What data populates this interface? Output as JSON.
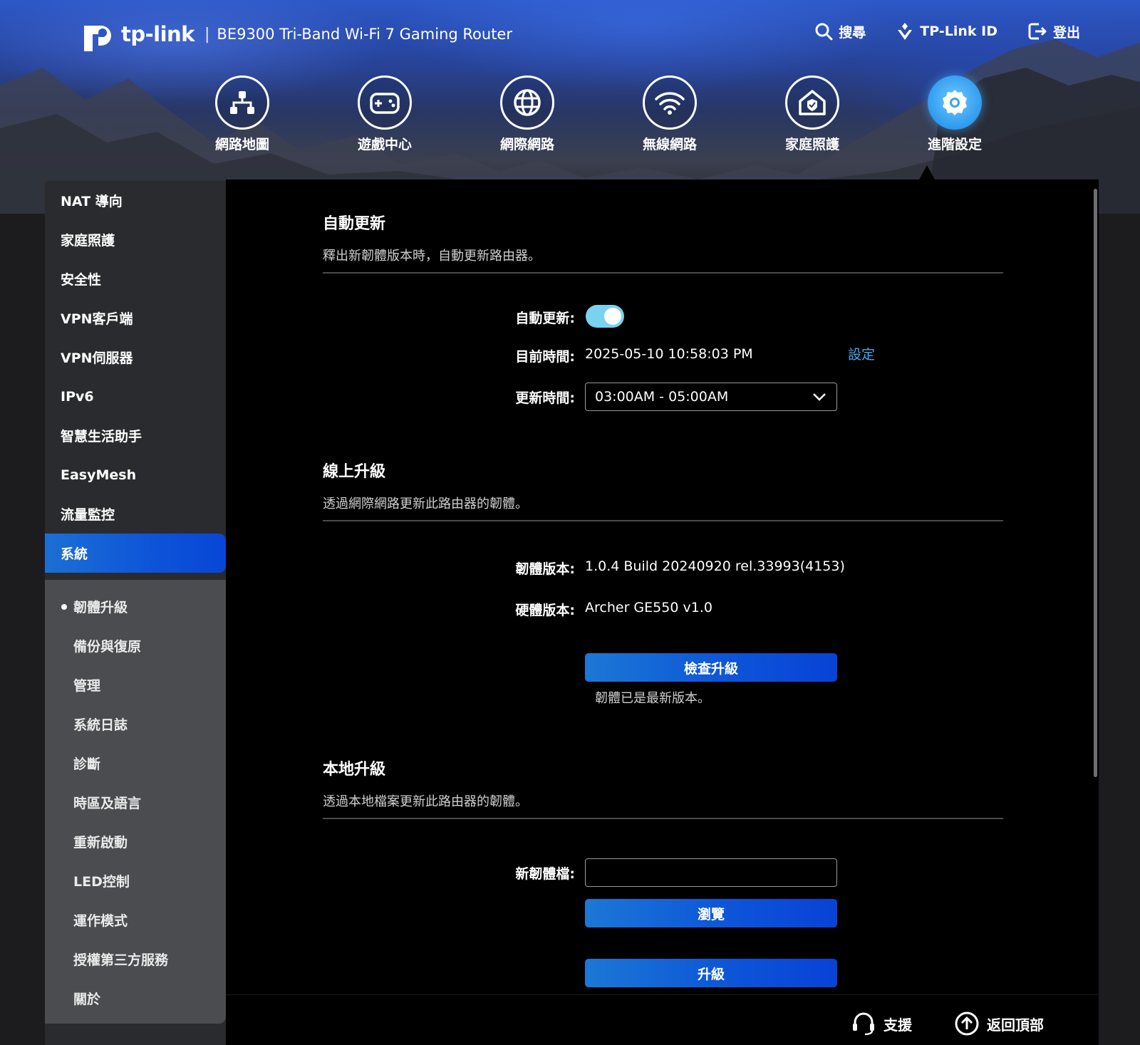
{
  "header": {
    "logo_text": "tp-link",
    "separator": "|",
    "model": "BE9300 Tri-Band Wi-Fi 7 Gaming Router",
    "actions": [
      {
        "label": "搜尋",
        "icon": "search-icon"
      },
      {
        "label": "TP-Link ID",
        "icon": "tplink-id-icon"
      },
      {
        "label": "登出",
        "icon": "logout-icon"
      }
    ]
  },
  "nav": [
    {
      "label": "網路地圖",
      "icon": "network-map-icon"
    },
    {
      "label": "遊戲中心",
      "icon": "gamepad-icon"
    },
    {
      "label": "網際網路",
      "icon": "globe-icon"
    },
    {
      "label": "無線網路",
      "icon": "wifi-icon"
    },
    {
      "label": "家庭照護",
      "icon": "home-shield-icon"
    },
    {
      "label": "進階設定",
      "icon": "gear-icon",
      "active": true
    }
  ],
  "sidebar": {
    "items": [
      "NAT 導向",
      "家庭照護",
      "安全性",
      "VPN客戶端",
      "VPN伺服器",
      "IPv6",
      "智慧生活助手",
      "EasyMesh",
      "流量監控",
      "系統"
    ],
    "active_item": "系統",
    "sub_items": [
      "韌體升級",
      "備份與復原",
      "管理",
      "系統日誌",
      "診斷",
      "時區及語言",
      "重新啟動",
      "LED控制",
      "運作模式",
      "授權第三方服務",
      "關於"
    ],
    "current_sub_item": "韌體升級"
  },
  "auto_update": {
    "title": "自動更新",
    "description": "釋出新韌體版本時，自動更新路由器。",
    "toggle_label": "自動更新:",
    "toggle_on": true,
    "current_time_label": "目前時間:",
    "current_time": "2025-05-10 10:58:03 PM",
    "set_link": "設定",
    "update_time_label": "更新時間:",
    "update_time": "03:00AM - 05:00AM"
  },
  "online_upgrade": {
    "title": "線上升級",
    "description": "透過網際網路更新此路由器的韌體。",
    "firmware_label": "韌體版本:",
    "firmware_version": "1.0.4 Build 20240920 rel.33993(4153)",
    "hardware_label": "硬體版本:",
    "hardware_version": "Archer GE550 v1.0",
    "check_button": "檢查升級",
    "status_text": "韌體已是最新版本。"
  },
  "local_upgrade": {
    "title": "本地升級",
    "description": "透過本地檔案更新此路由器的韌體。",
    "file_label": "新韌體檔:",
    "file_value": "",
    "browse_button": "瀏覽",
    "upgrade_button": "升級"
  },
  "footer": {
    "support": "支援",
    "back_to_top": "返回頂部"
  },
  "colors": {
    "accent_blue": "#0d56d8",
    "toggle_on": "#79d2f0",
    "link": "#4aa8f0",
    "panel_bg": "#000000",
    "sidebar_bg": "#2a2b2e",
    "submenu_bg": "#4a4c50"
  }
}
